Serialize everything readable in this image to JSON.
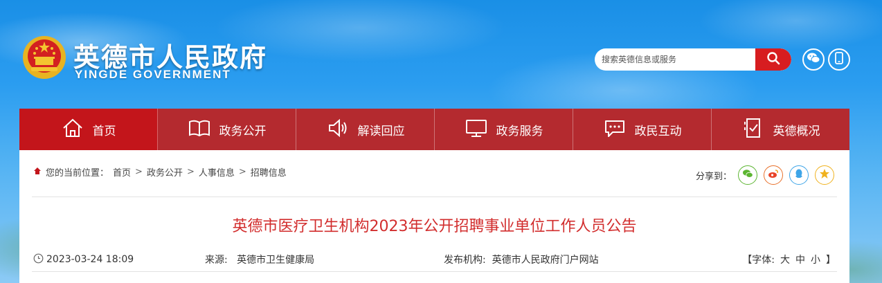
{
  "header": {
    "site_title": "英德市人民政府",
    "site_subtitle": "YINGDE GOVERNMENT",
    "emblem_icon": "national-emblem-icon",
    "search": {
      "placeholder": "搜索英德信息或服务",
      "button_icon": "search-icon"
    },
    "wechat_icon": "wechat-icon",
    "mobile_icon": "mobile-icon"
  },
  "nav": {
    "items": [
      {
        "label": "首页",
        "icon": "home-icon",
        "active": true
      },
      {
        "label": "政务公开",
        "icon": "book-icon"
      },
      {
        "label": "解读回应",
        "icon": "speaker-icon"
      },
      {
        "label": "政务服务",
        "icon": "monitor-icon"
      },
      {
        "label": "政民互动",
        "icon": "chat-bubble-icon"
      },
      {
        "label": "英德概况",
        "icon": "checklist-icon"
      }
    ]
  },
  "breadcrumb": {
    "prefix": "您的当前位置：",
    "items": [
      "首页",
      "政务公开",
      "人事信息",
      "招聘信息"
    ],
    "separator": ">"
  },
  "share": {
    "label": "分享到：",
    "targets": [
      "wechat",
      "weibo",
      "qq",
      "qzone"
    ]
  },
  "article": {
    "title": "英德市医疗卫生机构2023年公开招聘事业单位工作人员公告",
    "date": "2023-03-24 18:09",
    "source_label": "来源:",
    "source": "英德市卫生健康局",
    "publisher_label": "发布机构:",
    "publisher": "英德市人民政府门户网站",
    "font_label": "【字体:",
    "font_sizes": [
      "大",
      "中",
      "小"
    ],
    "font_close": "】"
  },
  "colors": {
    "nav_bg": "#b42a2f",
    "nav_active": "#c3151b",
    "title_red": "#d22d2d",
    "search_btn": "#d71d20"
  }
}
